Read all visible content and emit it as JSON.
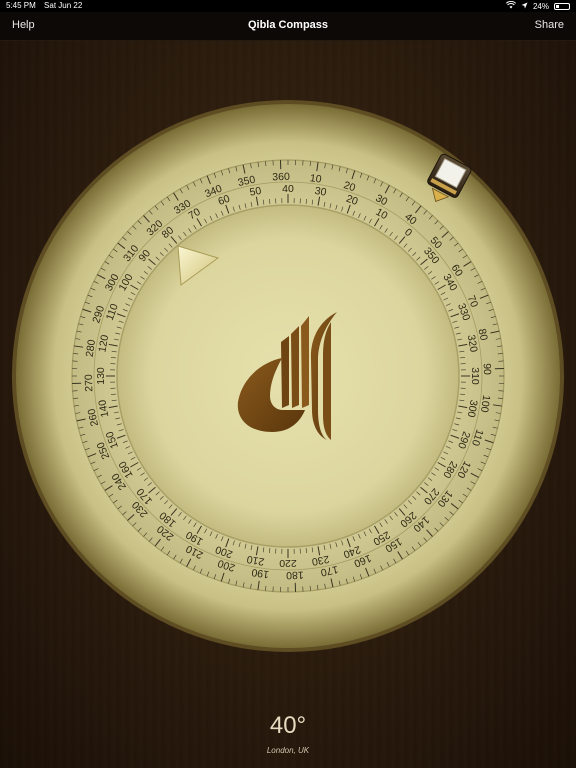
{
  "status_bar": {
    "time": "5:45 PM",
    "date": "Sat Jun 22",
    "battery": "24%",
    "icons": [
      "wifi-icon",
      "location-arrow-icon",
      "battery-icon"
    ]
  },
  "nav": {
    "left_label": "Help",
    "title": "Qibla Compass",
    "right_label": "Share"
  },
  "compass": {
    "outer_ring_labels": [
      "360",
      "10",
      "20",
      "30",
      "40",
      "50",
      "60",
      "70",
      "80",
      "90",
      "100",
      "110",
      "120",
      "130",
      "140",
      "150",
      "160",
      "170",
      "180",
      "190",
      "200",
      "210",
      "220",
      "230",
      "240",
      "250",
      "260",
      "270",
      "280",
      "290",
      "300",
      "310",
      "320",
      "330",
      "340",
      "350"
    ],
    "inner_ring_labels": [
      "0",
      "350",
      "340",
      "330",
      "320",
      "310",
      "300",
      "290",
      "280",
      "270",
      "260",
      "250",
      "240",
      "230",
      "220",
      "210",
      "200",
      "190",
      "180",
      "170",
      "160",
      "150",
      "140",
      "130",
      "120",
      "110",
      "100",
      "90",
      "80",
      "70",
      "60",
      "50",
      "40",
      "30",
      "20",
      "10"
    ],
    "qibla_marker_icon": "triangle-pointer-icon",
    "center_logo_icon": "qibla-logo-icon",
    "phone_marker_icon": "phone-marker-icon",
    "colors": {
      "dial": "#d8d29a",
      "dial_light": "#f3efc4",
      "logo": "#6a4312",
      "tick": "#3a3320"
    }
  },
  "readout": {
    "angle": "40°",
    "location": "London, UK"
  }
}
